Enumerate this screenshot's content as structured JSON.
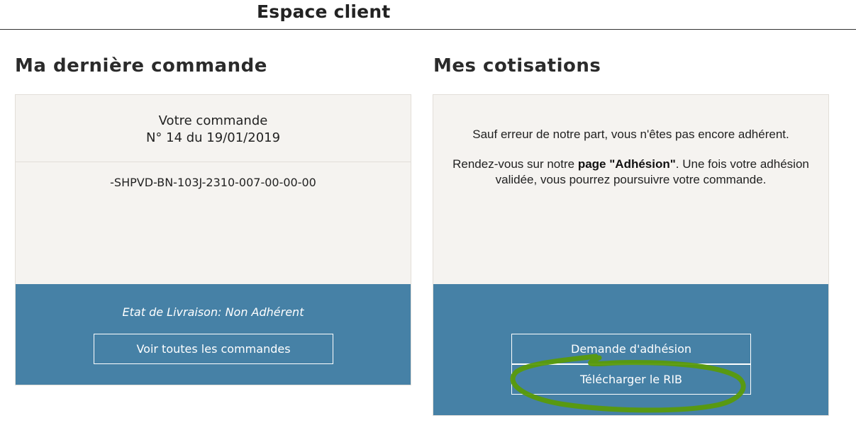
{
  "header": {
    "title": "Espace client"
  },
  "last_order": {
    "section_title": "Ma dernière commande",
    "label": "Votre commande",
    "number_line": "N° 14 du 19/01/2019",
    "reference": "-SHPVD-BN-103J-2310-007-00-00-00",
    "delivery_status": "Etat de Livraison: Non Adhérent",
    "view_all_button": "Voir toutes les commandes"
  },
  "subscriptions": {
    "section_title": "Mes cotisations",
    "notice_1": "Sauf erreur de notre part, vous n'êtes pas encore adhérent.",
    "notice_2_prefix": "Rendez-vous sur notre ",
    "notice_2_link": "page \"Adhésion\"",
    "notice_2_suffix": ". Une fois votre adhésion",
    "notice_2_line2": "validée, vous pourrez poursuivre votre commande.",
    "membership_button": "Demande d'adhésion",
    "rib_button": "Télécharger le RIB"
  },
  "colors": {
    "panel_background": "#f5f3f0",
    "accent_blue": "#4681a6",
    "annotation_green": "#5a9a0a"
  }
}
